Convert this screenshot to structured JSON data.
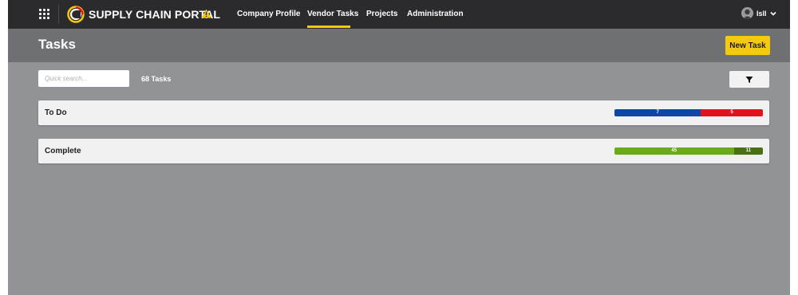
{
  "app": {
    "brand": "SUPPLY CHAIN PORTAL",
    "brand_colors": {
      "accent_yellow": "#f6c90e",
      "topbar": "#2b2b2d",
      "header": "#6f7074",
      "content_bg": "#929396"
    }
  },
  "nav": {
    "items": [
      {
        "label": "Company Profile",
        "active": false
      },
      {
        "label": "Vendor Tasks",
        "active": true
      },
      {
        "label": "Projects",
        "active": false
      },
      {
        "label": "Administration",
        "active": false
      }
    ]
  },
  "user": {
    "name": "Isll"
  },
  "header": {
    "title": "Tasks",
    "new_task_label": "New Task"
  },
  "search": {
    "placeholder": "Quick search...",
    "value": "",
    "count_label": "68 Tasks"
  },
  "icons": {
    "apps": "apps-grid-icon",
    "logo": "portal-logo-icon",
    "warning": "warning-icon",
    "avatar": "user-avatar",
    "chevron": "chevron-down-icon",
    "filter": "filter-icon"
  },
  "groups": [
    {
      "label": "To Do",
      "segments": [
        {
          "value": "7",
          "color": "#0d47a1",
          "fraction": 0.583
        },
        {
          "value": "5",
          "color": "#e3121f",
          "fraction": 0.417
        }
      ]
    },
    {
      "label": "Complete",
      "segments": [
        {
          "value": "45",
          "color": "#6aaa1c",
          "fraction": 0.804
        },
        {
          "value": "11",
          "color": "#4a7212",
          "fraction": 0.196
        }
      ]
    }
  ]
}
